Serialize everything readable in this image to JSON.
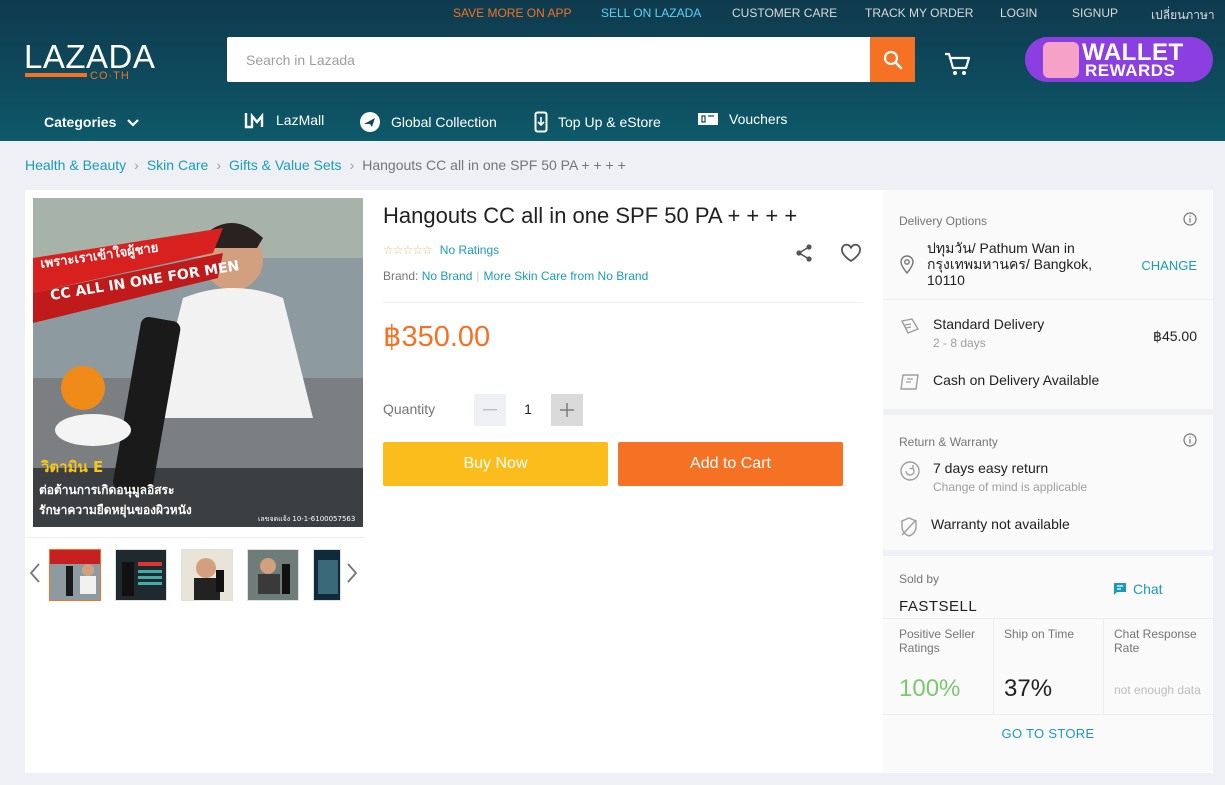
{
  "topbar": {
    "links": [
      "SAVE MORE ON APP",
      "SELL ON LAZADA",
      "CUSTOMER CARE",
      "TRACK MY ORDER",
      "LOGIN",
      "SIGNUP",
      "เปลี่ยนภาษา"
    ]
  },
  "logo": {
    "word": "LAZADA",
    "sub": "CO·TH"
  },
  "search": {
    "placeholder": "Search in Lazada",
    "value": ""
  },
  "wallet": {
    "line1": "WALLET",
    "line2": "REWARDS"
  },
  "nav": {
    "categories": "Categories",
    "items": [
      {
        "label": "LazMall",
        "icon": "lazmall-icon"
      },
      {
        "label": "Global Collection",
        "icon": "plane-globe-icon"
      },
      {
        "label": "Top Up & eStore",
        "icon": "mobile-topup-icon"
      },
      {
        "label": "Vouchers",
        "icon": "voucher-icon"
      }
    ]
  },
  "breadcrumb": {
    "items": [
      "Health & Beauty",
      "Skin Care",
      "Gifts & Value Sets"
    ],
    "current": "Hangouts CC all in one SPF 50 PA + + + +"
  },
  "product": {
    "title": "Hangouts CC all in one SPF 50 PA + + + +",
    "ratings": "No Ratings",
    "brand_label": "Brand:",
    "brand": "No Brand",
    "more_from": "More Skin Care from No Brand",
    "price": "฿350.00",
    "quantity_label": "Quantity",
    "quantity": "1",
    "buy_now": "Buy Now",
    "add_to_cart": "Add to Cart",
    "image_text": {
      "banner1": "เพราะเราเข้าใจผู้ชาย",
      "banner2": "CC ALL IN ONE FOR MEN",
      "vitamin": "วิตามิน E",
      "line1": "ต่อต้านการเกิดอนุมูลอิสระ",
      "line2": "รักษาความยืดหยุ่นของผิวหนัง",
      "reg": "เลขจดแจ้ง 10-1-6100057563"
    }
  },
  "delivery": {
    "title": "Delivery Options",
    "address": "ปทุมวัน/ Pathum Wan in กรุงเทพมหานคร/ Bangkok, 10110",
    "change": "CHANGE",
    "standard": "Standard Delivery",
    "standard_days": "2 - 8 days",
    "standard_fee": "฿45.00",
    "cod": "Cash on Delivery Available"
  },
  "warranty": {
    "title": "Return & Warranty",
    "return": "7 days easy return",
    "return_sub": "Change of mind is applicable",
    "warranty": "Warranty not available"
  },
  "seller": {
    "sold_by": "Sold by",
    "name": "FASTSELL",
    "chat": "Chat",
    "metrics": [
      {
        "label": "Positive Seller Ratings",
        "value": "100%"
      },
      {
        "label": "Ship on Time",
        "value": "37%"
      },
      {
        "label": "Chat Response Rate",
        "value": "not enough data"
      }
    ],
    "go_to_store": "GO TO STORE"
  },
  "colors": {
    "accent": "#f57224",
    "link": "#1a9cb7",
    "buy": "#fbbd1b",
    "header": "#0f3a4d",
    "wallet": "#8c3fe0"
  }
}
